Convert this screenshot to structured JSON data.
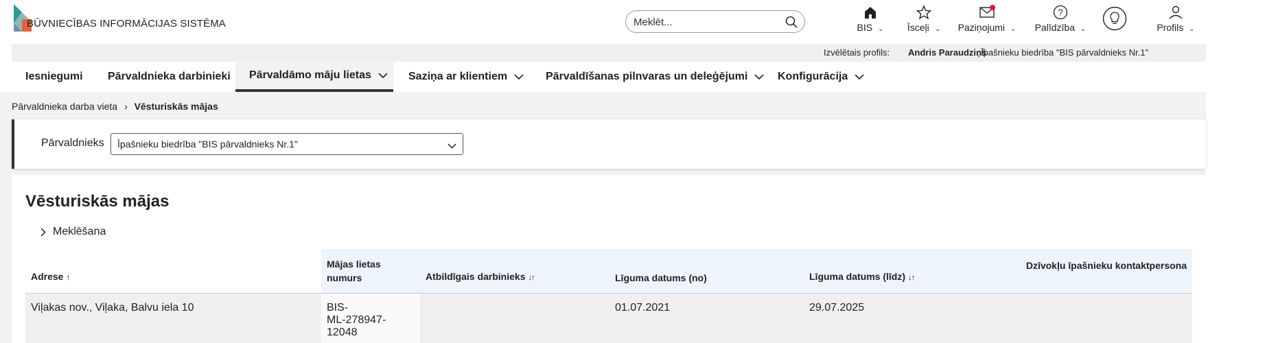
{
  "app": {
    "logo_text": "BŪVNIECĪBAS INFORMĀCIJAS SISTĒMA",
    "brand_colors": {
      "teal": "#2b9c92",
      "orange": "#e8623a",
      "grey": "#8a9aa8"
    }
  },
  "search": {
    "placeholder": "Meklēt..."
  },
  "topnav": {
    "bis": "BIS",
    "shortcuts": "Īsceļi",
    "notifications": "Paziņojumi",
    "help": "Palīdzība",
    "profile": "Profils"
  },
  "profile_strip": {
    "label": "Izvēlētais profils:",
    "user": "Andris Paraudziņš",
    "org": "Īpašnieku biedrība \"BIS pārvaldnieks Nr.1\""
  },
  "mainnav": {
    "tabs": [
      {
        "label": "Iesniegumi"
      },
      {
        "label": "Pārvaldnieka darbinieki"
      },
      {
        "label": "Pārvaldāmo māju lietas"
      },
      {
        "label": "Saziņa ar klientiem"
      },
      {
        "label": "Pārvaldīšanas pilnvaras un deleģējumi"
      },
      {
        "label": "Konfigurācija"
      }
    ]
  },
  "breadcrumb": {
    "parent": "Pārvaldnieka darba vieta",
    "current": "Vēsturiskās mājas"
  },
  "filter": {
    "label": "Pārvaldnieks",
    "selected": "Īpašnieku biedrība \"BIS pārvaldnieks Nr.1\""
  },
  "content": {
    "title": "Vēsturiskās mājas",
    "search_toggle": "Meklēšana"
  },
  "table": {
    "headers": {
      "address": "Adrese",
      "case_number": "Mājas lietas numurs",
      "responsible": "Atbildīgais darbinieks",
      "date_from": "Līguma datums (no)",
      "date_to": "Līguma datums (līdz)",
      "contact": "Dzīvokļu īpašnieku kontaktpersona"
    },
    "rows": [
      {
        "address": "Viļakas nov., Viļaka, Balvu iela 10",
        "case_number": "BIS-ML-278947-12048",
        "responsible": "",
        "date_from": "01.07.2021",
        "date_to": "29.07.2025",
        "contact": ""
      }
    ]
  }
}
